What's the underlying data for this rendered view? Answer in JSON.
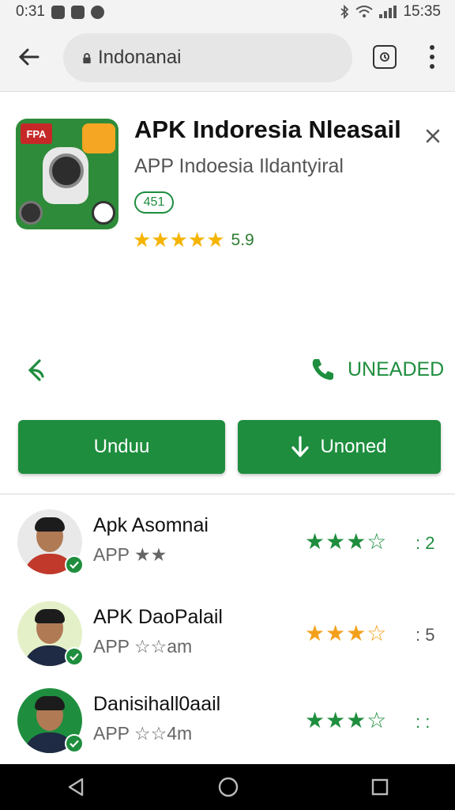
{
  "status_bar": {
    "time": "0:31",
    "right_time": "15:35"
  },
  "browser": {
    "url": "Indonanai"
  },
  "app": {
    "title": "APK Indoresia Nleasail",
    "subtitle": "APP Indoesia Ildantyiral",
    "age_badge": "451",
    "icon_badge": "FPA",
    "stars": "★★★★★",
    "rating": "5.9",
    "rating_value": 5,
    "action_label": "UNEADED"
  },
  "buttons": {
    "primary": "Unduu",
    "secondary": "Unoned"
  },
  "list": [
    {
      "name": "Apk Asomnai",
      "sub": "APP ★★",
      "stars": "★★★☆",
      "count": ": 2",
      "star_color": "green",
      "rating_value": 3
    },
    {
      "name": "APK DaoPalail",
      "sub": "APP ☆☆am",
      "stars": "★★★☆",
      "count": ": 5",
      "star_color": "orange",
      "rating_value": 3
    },
    {
      "name": "Danisihall0aail",
      "sub": "APP ☆☆4m",
      "stars": "★★★☆",
      "count": ": :",
      "star_color": "green",
      "rating_value": 3
    }
  ],
  "colors": {
    "accent": "#1e8e3e",
    "star_gold": "#f4b400",
    "star_orange": "#f4a01c"
  }
}
